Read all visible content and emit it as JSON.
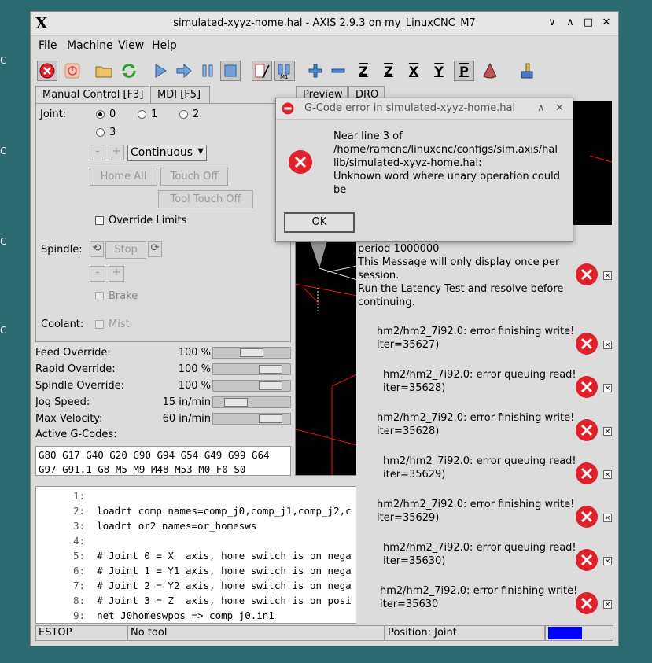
{
  "desktop": {
    "edge_labels": [
      "C",
      "C",
      "C",
      "C"
    ]
  },
  "window": {
    "title": "simulated-xyyz-home.hal - AXIS 2.9.3 on my_LinuxCNC_M7",
    "controls": {
      "minimize": "∨",
      "maximize": "∧",
      "restore": "□",
      "close": "✕"
    }
  },
  "menu": [
    "File",
    "Machine",
    "View",
    "Help"
  ],
  "toolbar_axis_labels": [
    "Z",
    "Z",
    "X",
    "Y",
    "P"
  ],
  "tabs": [
    "Manual Control [F3]",
    "MDI [F5]"
  ],
  "manual": {
    "joint_label": "Joint:",
    "joints": [
      "0",
      "1",
      "2",
      "3"
    ],
    "selected_joint": "0",
    "minus": "-",
    "plus": "+",
    "jog_mode": "Continuous",
    "home_all": "Home All",
    "touch_off": "Touch Off",
    "tool_touch_off": "Tool Touch Off",
    "override_limits": "Override Limits",
    "spindle_label": "Spindle:",
    "stop": "Stop",
    "brake": "Brake",
    "coolant_label": "Coolant:",
    "mist": "Mist"
  },
  "overrides": [
    {
      "label": "Feed Override:",
      "value": "100 %",
      "level": 0.5
    },
    {
      "label": "Rapid Override:",
      "value": "100 %",
      "level": 0.85
    },
    {
      "label": "Spindle Override:",
      "value": "100 %",
      "level": 0.85
    },
    {
      "label": "Jog Speed:",
      "value": "15 in/min",
      "level": 0.2
    },
    {
      "label": "Max Velocity:",
      "value": "60 in/min",
      "level": 0.85
    }
  ],
  "active_gcodes_label": "Active G-Codes:",
  "active_gcodes": [
    "G80 G17 G40 G20 G90 G94 G54 G49 G99 G64",
    "G97 G91.1 G8 M5 M9 M48 M53 M0 F0 S0"
  ],
  "code_lines": [
    {
      "n": "1:",
      "text": ""
    },
    {
      "n": "2:",
      "text": "loadrt comp names=comp_j0,comp_j1,comp_j2,c"
    },
    {
      "n": "3:",
      "text": "loadrt or2 names=or_homesws"
    },
    {
      "n": "4:",
      "text": ""
    },
    {
      "n": "5:",
      "text": "# Joint 0 = X  axis, home switch is on nega"
    },
    {
      "n": "6:",
      "text": "# Joint 1 = Y1 axis, home switch is on nega"
    },
    {
      "n": "7:",
      "text": "# Joint 2 = Y2 axis, home switch is on nega"
    },
    {
      "n": "8:",
      "text": "# Joint 3 = Z  axis, home switch is on posi"
    },
    {
      "n": "9:",
      "text": "net J0homeswpos => comp_j0.in1"
    }
  ],
  "status": {
    "estop": "ESTOP",
    "tool": "No tool",
    "position": "Position: Joint",
    "indicator_color": "#0000ff"
  },
  "preview_tabs": [
    "Preview",
    "DRO"
  ],
  "latency_notice": [
    "period 1000000",
    "This Message will only display once per",
    "session.",
    "Run the Latency Test and resolve before",
    "continuing."
  ],
  "error_notices": [
    {
      "line1": "hm2/hm2_7i92.0: error finishing write!",
      "line2": "iter=35627)"
    },
    {
      "line1": "hm2/hm2_7i92.0: error queuing read!",
      "line2": "iter=35628)"
    },
    {
      "line1": "hm2/hm2_7i92.0: error finishing write!",
      "line2": "iter=35628)"
    },
    {
      "line1": "hm2/hm2_7i92.0: error queuing read!",
      "line2": "iter=35629)"
    },
    {
      "line1": "hm2/hm2_7i92.0: error finishing write!",
      "line2": "iter=35629)"
    },
    {
      "line1": "hm2/hm2_7i92.0: error queuing read!",
      "line2": "iter=35630)"
    },
    {
      "line1": "hm2/hm2_7i92.0: error finishing write!",
      "line2": "iter=35630"
    }
  ],
  "notice_close": "×",
  "dialog": {
    "title": "G-Code error in simulated-xyyz-home.hal",
    "message": [
      "Near line 3 of",
      "/home/ramcnc/linuxcnc/configs/sim.axis/hal",
      "lib/simulated-xyyz-home.hal:",
      "Unknown word where unary operation could",
      "be"
    ],
    "ok": "OK",
    "controls": {
      "minimize": "∧",
      "close": "✕"
    }
  },
  "colors": {
    "error_red": "#e0202a",
    "desktop": "#2b6b70",
    "window_bg": "#dcdcdc"
  }
}
